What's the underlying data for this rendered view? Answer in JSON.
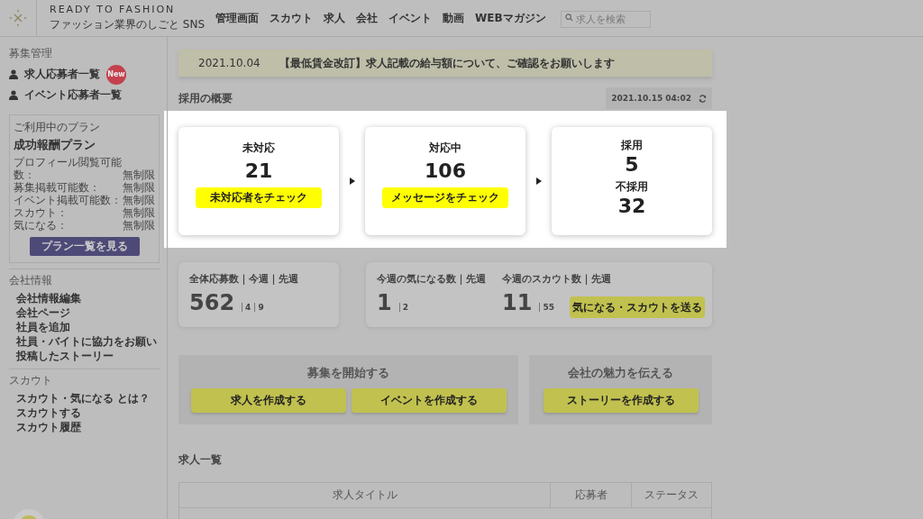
{
  "header": {
    "brand": "READY TO FASHION",
    "tagline": "ファッション業界のしごと SNS",
    "nav": [
      "管理画面",
      "スカウト",
      "求人",
      "会社",
      "イベント",
      "動画",
      "WEBマガジン"
    ],
    "search": {
      "placeholder": "求人を検索"
    }
  },
  "sidebar": {
    "section_label": "募集管理",
    "items": [
      {
        "label": "求人応募者一覧",
        "badge": "New"
      },
      {
        "label": "イベント応募者一覧"
      }
    ],
    "plan": {
      "caption": "ご利用中のプラン",
      "name": "成功報酬プラン",
      "rows": [
        {
          "label": "プロフィール閲覧可能数：",
          "value": "無制限"
        },
        {
          "label": "募集掲載可能数：",
          "value": "無制限"
        },
        {
          "label": "イベント掲載可能数：",
          "value": "無制限"
        },
        {
          "label": "スカウト：",
          "value": "無制限"
        },
        {
          "label": "気になる：",
          "value": "無制限"
        }
      ],
      "button": "プラン一覧を見る"
    },
    "sections": [
      {
        "label": "会社情報",
        "links": [
          "会社情報編集",
          "会社ページ",
          "社員を追加",
          "社員・バイトに協力をお願い",
          "投稿したストーリー"
        ]
      },
      {
        "label": "スカウト",
        "links": [
          "スカウト・気になる とは？",
          "スカウトする",
          "スカウト履歴"
        ]
      }
    ]
  },
  "notice": {
    "date": "2021.10.04",
    "text": "【最低賃金改訂】求人記載の給与額について、ご確認をお願いします"
  },
  "overview": {
    "title": "採用の概要",
    "timestamp": "2021.10.15 04:02",
    "stages": [
      {
        "label": "未対応",
        "value": "21",
        "button": "未対応者をチェック"
      },
      {
        "label": "対応中",
        "value": "106",
        "button": "メッセージをチェック"
      }
    ],
    "results": [
      {
        "label": "採用",
        "value": "5"
      },
      {
        "label": "不採用",
        "value": "32"
      }
    ]
  },
  "stats": [
    {
      "label": "全体応募数｜今週｜先週",
      "value": "562",
      "this_week": "4",
      "last_week": "9"
    },
    {
      "label": "今週の気になる数｜先週",
      "value": "1",
      "last_week": "2"
    },
    {
      "label": "今週のスカウト数｜先週",
      "value": "11",
      "last_week": "55"
    }
  ],
  "stats_button": "気になる・スカウトを送る",
  "actions": [
    {
      "title": "募集を開始する",
      "buttons": [
        "求人を作成する",
        "イベントを作成する"
      ]
    },
    {
      "title": "会社の魅力を伝える",
      "buttons": [
        "ストーリーを作成する"
      ]
    }
  ],
  "jobs": {
    "title": "求人一覧",
    "columns": [
      "求人タイトル",
      "応募者",
      "ステータス"
    ]
  }
}
